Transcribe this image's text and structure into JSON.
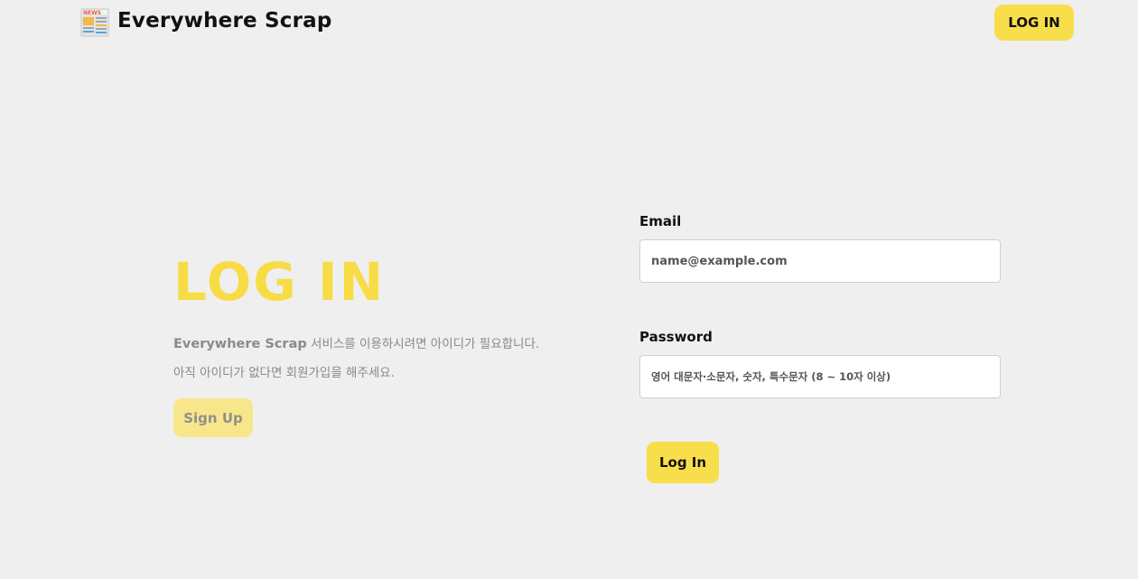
{
  "header": {
    "brand": "Everywhere Scrap",
    "logo_icon": "newspaper-icon",
    "login_label": "LOG IN"
  },
  "hero": {
    "title": "LOG IN",
    "line1_brand": "Everywhere Scrap",
    "line1_rest": " 서비스를 이용하시려면 아이디가 필요합니다.",
    "line2": "아직 아이디가 없다면 회원가입을 해주세요.",
    "signup_label": "Sign Up"
  },
  "form": {
    "email_label": "Email",
    "email_placeholder": "name@example.com",
    "email_value": "",
    "password_label": "Password",
    "password_placeholder": "영어 대문자·소문자, 숫자, 특수문자 (8 ~ 10자 이상)",
    "password_value": "",
    "submit_label": "Log In"
  },
  "colors": {
    "background": "#efefef",
    "accent": "#f8de4a",
    "accent_light": "#f8e78a",
    "muted_text": "#8a8a8a"
  }
}
